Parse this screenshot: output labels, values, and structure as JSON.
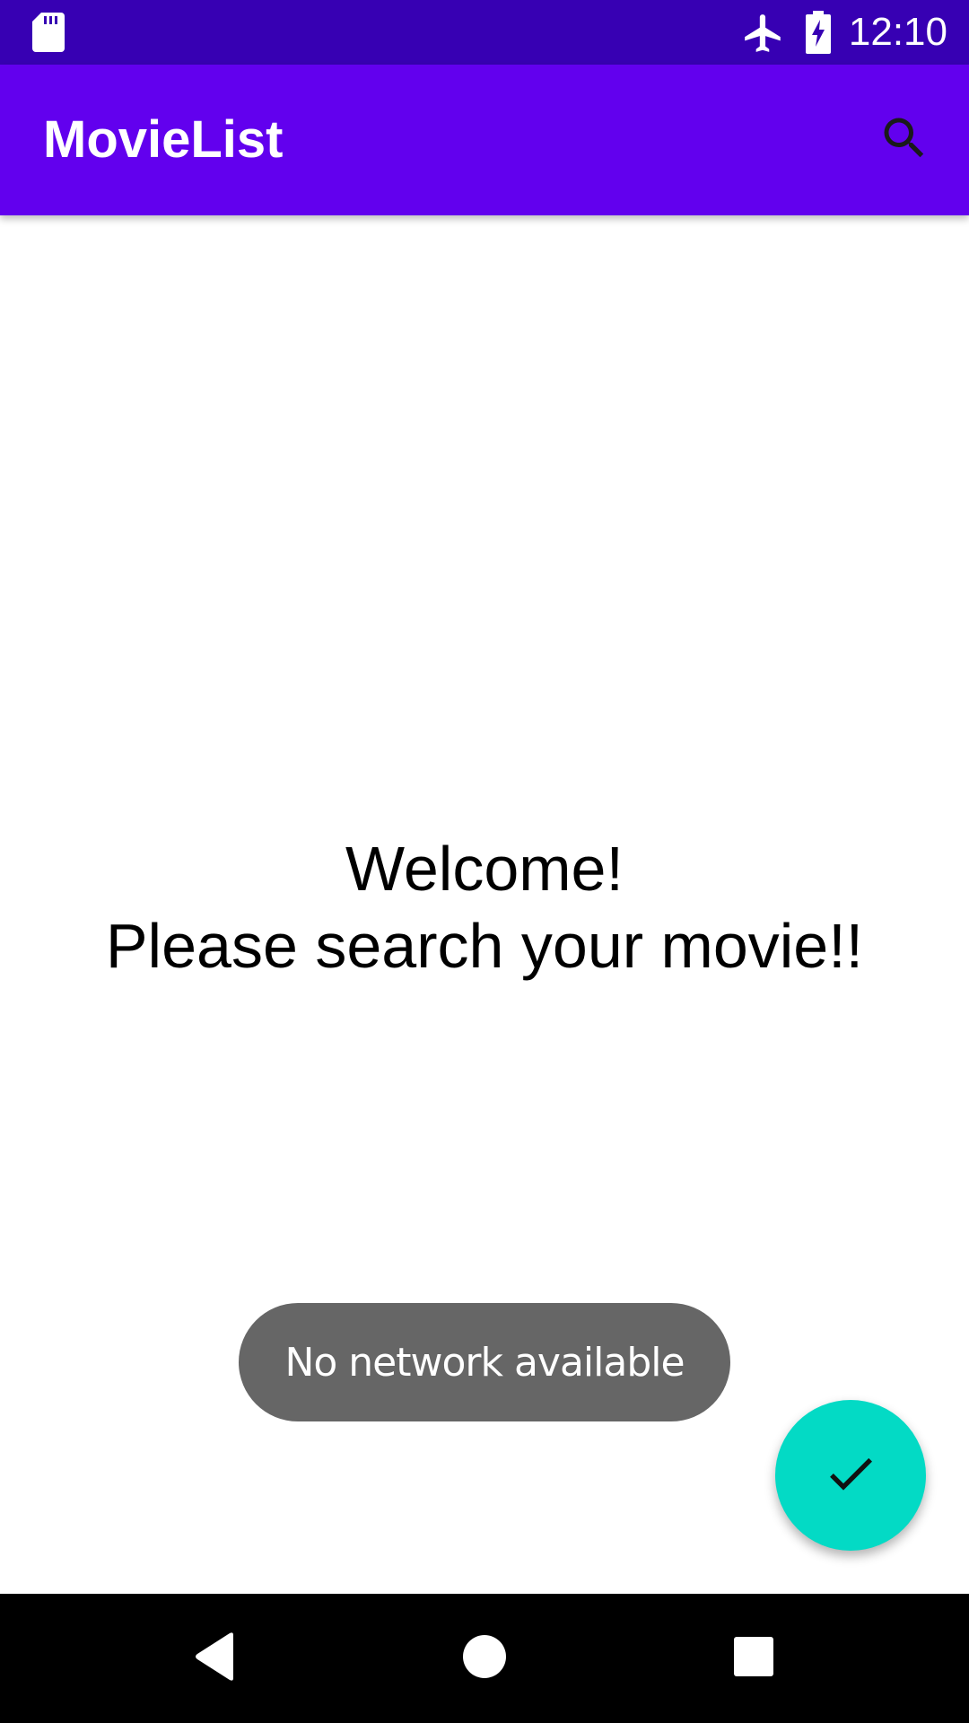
{
  "status_bar": {
    "time": "12:10",
    "icons": [
      "sd-card-icon",
      "airplane-mode-icon",
      "battery-charging-icon"
    ]
  },
  "app_bar": {
    "title": "MovieList",
    "search_icon": "search-icon"
  },
  "main": {
    "welcome_line1": "Welcome!",
    "welcome_line2": "Please search your movie!!"
  },
  "toast": {
    "message": "No network available"
  },
  "fab": {
    "icon": "check-icon"
  },
  "nav_bar": {
    "buttons": [
      "back-icon",
      "home-icon",
      "recents-icon"
    ]
  },
  "colors": {
    "status_bar": "#3700b3",
    "app_bar": "#6200ee",
    "fab": "#03dac5",
    "toast": "#666666"
  }
}
